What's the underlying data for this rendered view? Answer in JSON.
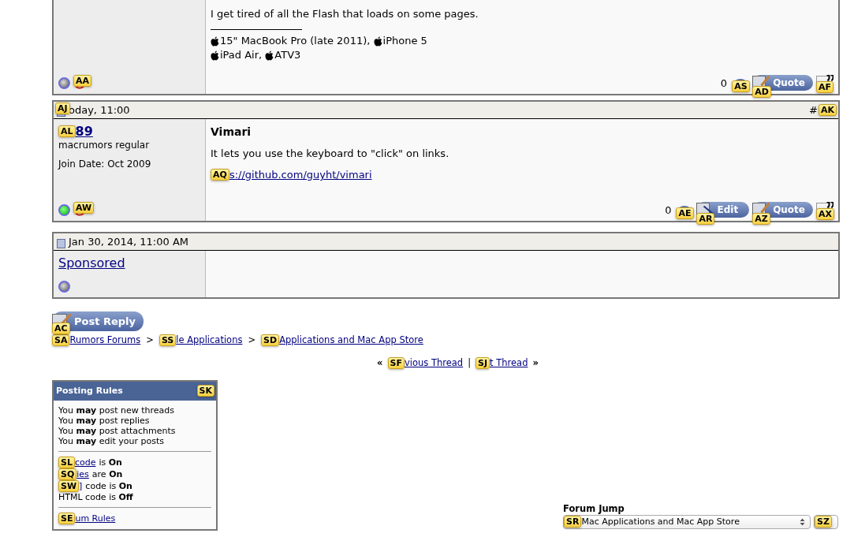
{
  "posts": [
    {
      "body": "I get tired of all the Flash that loads on some pages.",
      "signature": [
        [
          "15\" MacBook Pro (late 2011), ",
          "iPhone 5"
        ],
        [
          "iPad Air, ",
          "ATV3"
        ]
      ],
      "online": false,
      "report_hint": "AA",
      "thanks_count": "0",
      "thanks_hint": "AS",
      "buttons": [
        {
          "kind": "quote",
          "label": "Quote",
          "hint": "AD"
        }
      ],
      "multiquote_hint": "AF"
    },
    {
      "header": {
        "hint": "AJ",
        "date": "oday, 11:00",
        "number": "#",
        "number_hint": "AK"
      },
      "user": {
        "name": "89",
        "hint": "AL",
        "bold": true,
        "title": "macrumors regular",
        "join_date": "Join Date: Oct 2009"
      },
      "online": true,
      "report_hint": "AW",
      "title": "Vimari",
      "body": "It lets you use the keyboard to \"click\" on links.",
      "link": {
        "hint": "AQ",
        "text": "s://github.com/guyht/vimari"
      },
      "thanks_count": "0",
      "thanks_hint": "AE",
      "buttons": [
        {
          "kind": "edit",
          "label": "Edit",
          "hint": "AR"
        },
        {
          "kind": "quote",
          "label": "Quote",
          "hint": "AZ"
        }
      ],
      "multiquote_hint": "AX"
    },
    {
      "header": {
        "date": "Jan 30, 2014, 11:00 AM"
      },
      "user": {
        "name": "Sponsored",
        "bold": false
      },
      "online": false
    }
  ],
  "post_reply": {
    "label": "Post Reply",
    "hint": "AC"
  },
  "breadcrumb": {
    "separator": ">",
    "items": [
      {
        "hint": "SA",
        "text": "Rumors Forums"
      },
      {
        "hint": "SS",
        "text": "le Applications"
      },
      {
        "hint": "SD",
        "text": "Applications and Mac App Store"
      }
    ]
  },
  "thread_nav": {
    "left": "«",
    "separator": "|",
    "right": "»",
    "items": [
      {
        "hint": "SF",
        "text": "vious Thread"
      },
      {
        "hint": "SJ",
        "text": "t Thread"
      }
    ]
  },
  "posting_rules": {
    "title": "Posting Rules",
    "hint": "SK",
    "permissions": [
      "You **may** post new threads",
      "You **may** post replies",
      "You **may** post attachments",
      "You **may** edit your posts"
    ],
    "settings": [
      {
        "hint": "SL",
        "link": "code",
        "rest": "is **On**"
      },
      {
        "hint": "SQ",
        "link": "ies",
        "rest": "are **On**"
      },
      {
        "hint": "SW",
        "link": "]",
        "rest": "code is **On**"
      },
      {
        "text": "HTML code is **Off**"
      }
    ],
    "footer": {
      "hint": "SE",
      "link": "um Rules"
    }
  },
  "forum_jump": {
    "label": "Forum Jump",
    "select": {
      "hint": "SR",
      "value": "Mac Applications and Mac App Store"
    },
    "go_hint": "SZ"
  }
}
